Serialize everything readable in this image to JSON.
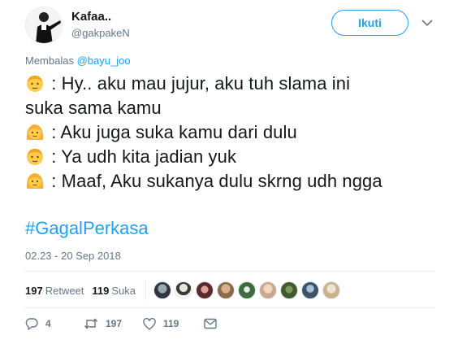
{
  "user": {
    "display_name": "Kafaa..",
    "handle": "@gakpakeN"
  },
  "follow_label": "Ikuti",
  "reply": {
    "prefix": "Membalas ",
    "mention": "@bayu_joo"
  },
  "tweet": {
    "lines": [
      {
        "emoji": "boy-emoji",
        "text": " : Hy.. aku mau jujur, aku tuh slama ini"
      },
      {
        "emoji": "",
        "text": "suka sama kamu"
      },
      {
        "emoji": "girl-emoji",
        "text": " : Aku juga suka kamu dari dulu"
      },
      {
        "emoji": "boy-emoji",
        "text": " : Ya udh kita jadian yuk"
      },
      {
        "emoji": "girl-emoji",
        "text": " : Maaf, Aku sukanya dulu skrng udh ngga"
      }
    ],
    "hashtag": "#GagalPerkasa"
  },
  "timestamp": "02.23 - 20 Sep 2018",
  "stats": {
    "retweets_count": "197",
    "retweets_label": "Retweet",
    "likes_count": "119",
    "likes_label": "Suka"
  },
  "actions": {
    "reply_count": "4",
    "retweet_count": "197",
    "like_count": "119"
  },
  "colors": {
    "accent": "#1da1f2",
    "muted": "#657786",
    "text": "#14171a",
    "divider": "#e6ecf0"
  }
}
